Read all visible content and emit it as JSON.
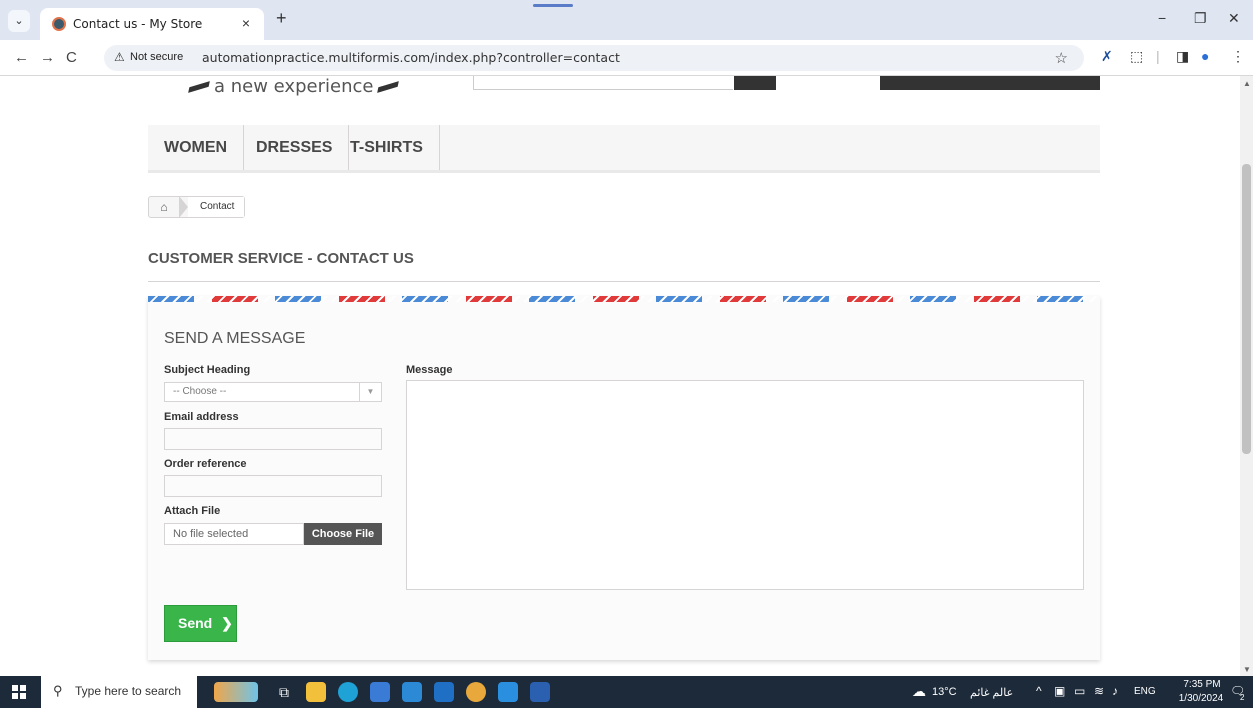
{
  "browser": {
    "tab_title": "Contact us - My Store",
    "tab_close": "×",
    "new_tab": "+",
    "tab_list": "⌄",
    "not_secure": "Not secure",
    "url": "automationpractice.multiformis.com/index.php?controller=contact",
    "window_controls": {
      "minimize": "−",
      "maximize": "❐",
      "close": "✕"
    }
  },
  "header": {
    "tagline": "a new experience"
  },
  "menu": {
    "items": [
      "WOMEN",
      "DRESSES",
      "T-SHIRTS"
    ]
  },
  "breadcrumb": {
    "current": "Contact"
  },
  "page": {
    "heading": "CUSTOMER SERVICE - CONTACT US"
  },
  "contact_form": {
    "title": "SEND A MESSAGE",
    "subject_label": "Subject Heading",
    "subject_value": "-- Choose --",
    "email_label": "Email address",
    "email_value": "",
    "order_label": "Order reference",
    "order_value": "",
    "attach_label": "Attach File",
    "file_name": "No file selected",
    "choose_file_label": "Choose File",
    "message_label": "Message",
    "message_value": "",
    "send_label": "Send",
    "send_arrow": "❯"
  },
  "taskbar": {
    "search_placeholder": "Type here to search",
    "weather": "13°C",
    "weather_text": "عالم غائم",
    "lang": "ENG",
    "time": "7:35 PM",
    "date": "1/30/2024",
    "notifications": "2"
  },
  "colors": {
    "send_green": "#3ab54a",
    "stripe_blue": "#4a8ad6",
    "stripe_red": "#e13a3a",
    "taskbar": "#1c2a3a"
  }
}
